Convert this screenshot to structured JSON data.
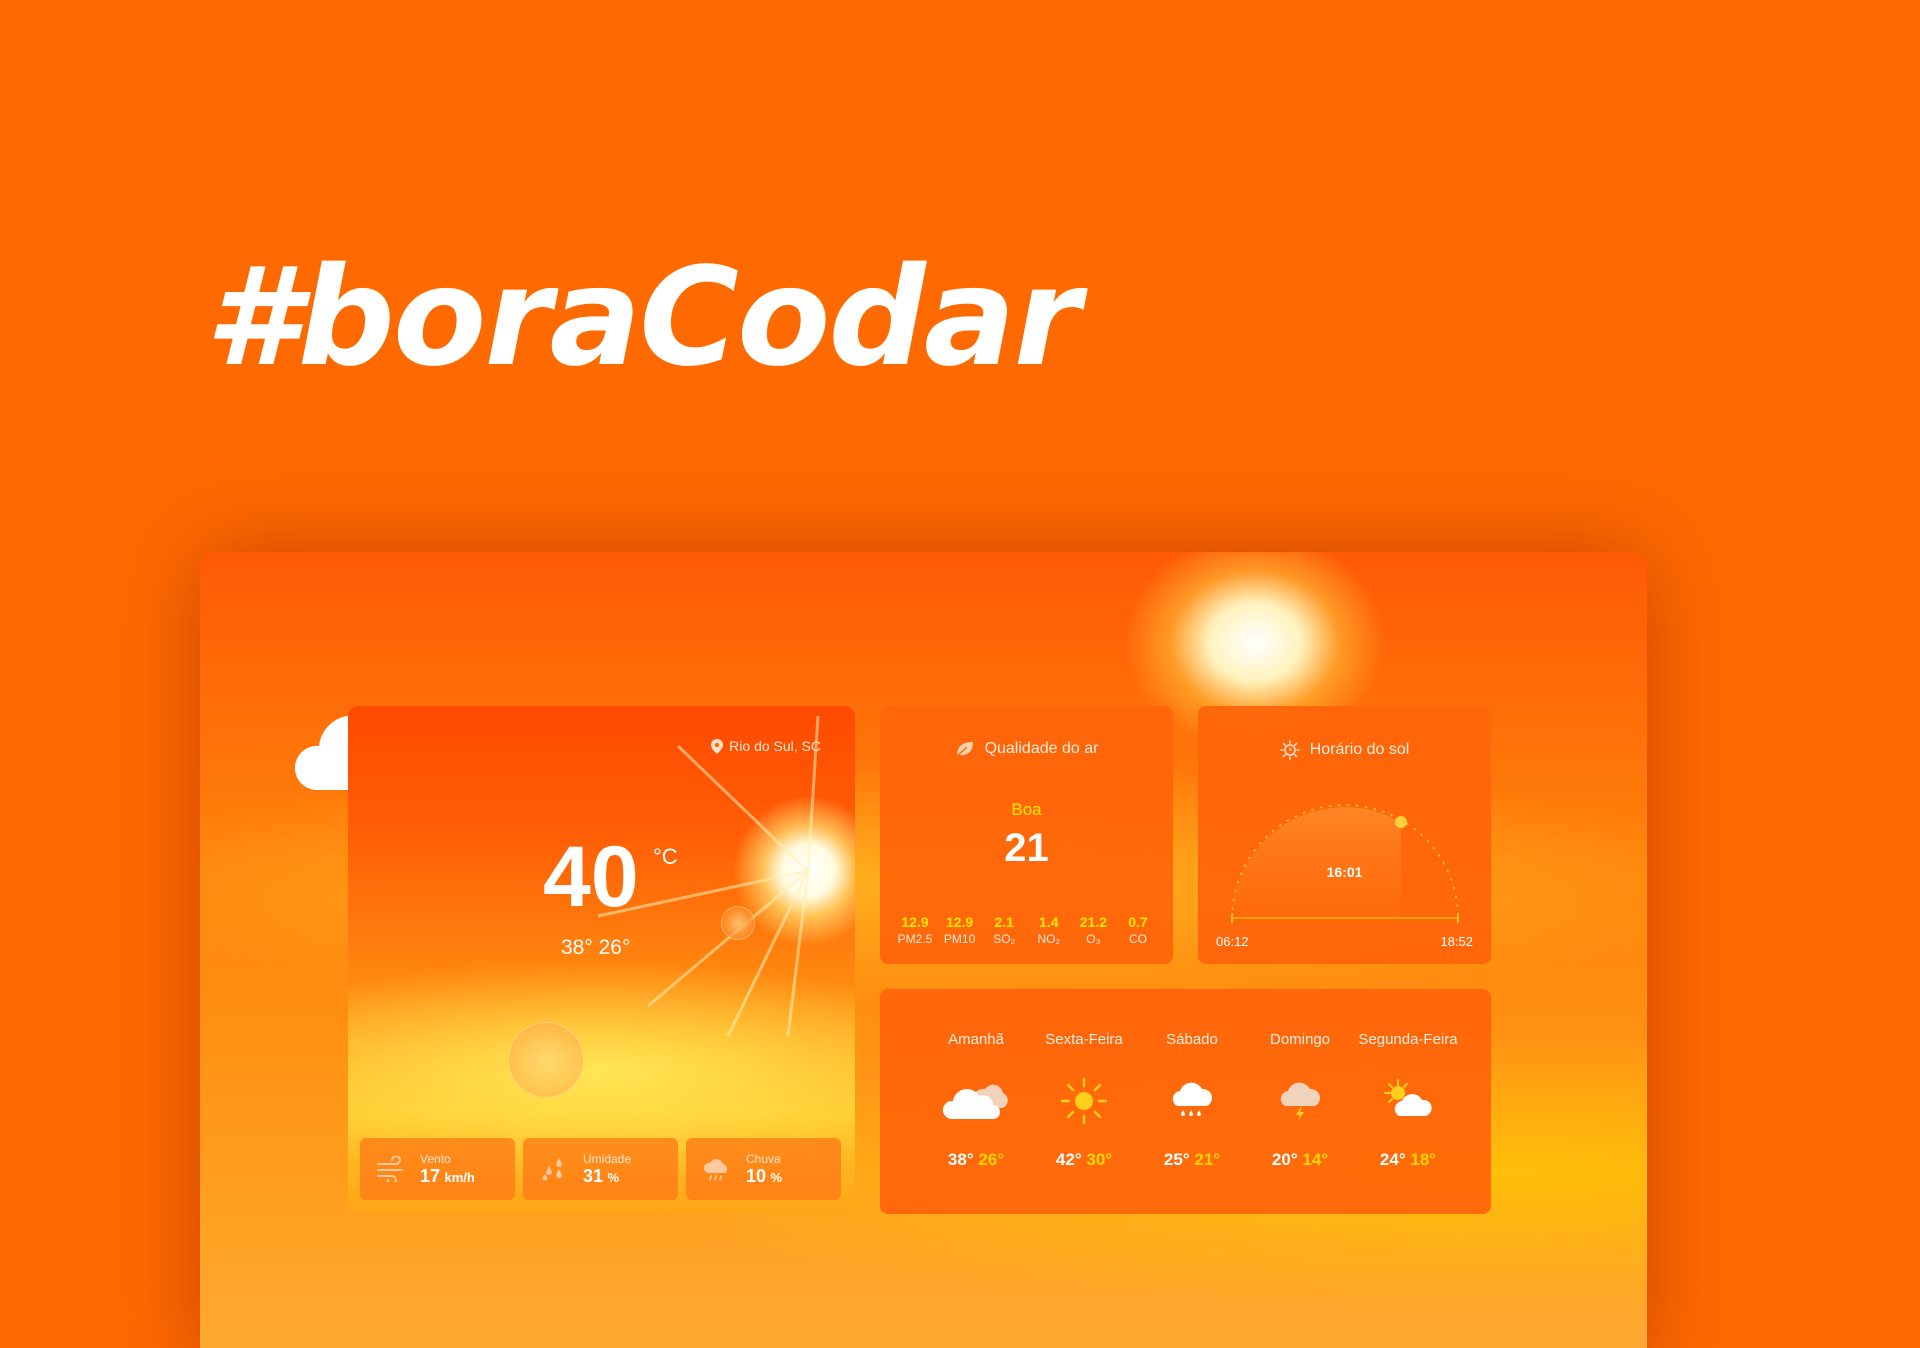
{
  "headline": "#boraCodar",
  "weather": {
    "location": "Rio do Sul, SC",
    "temperature": "40",
    "unit": "°C",
    "max": "38°",
    "min": "26°",
    "stats": [
      {
        "label": "Vento",
        "value": "17",
        "unit": "km/h",
        "icon": "wind-icon"
      },
      {
        "label": "Umidade",
        "value": "31",
        "unit": "%",
        "icon": "humidity-icon"
      },
      {
        "label": "Chuva",
        "value": "10",
        "unit": "%",
        "icon": "rain-cloud-icon"
      }
    ]
  },
  "air_quality": {
    "title": "Qualidade do ar",
    "status": "Boa",
    "index": "21",
    "pollutants": [
      {
        "value": "12.9",
        "label": "PM2.5"
      },
      {
        "value": "12.9",
        "label": "PM10"
      },
      {
        "value": "2.1",
        "label": "SO₂"
      },
      {
        "value": "1.4",
        "label": "NO₂"
      },
      {
        "value": "21.2",
        "label": "O₃"
      },
      {
        "value": "0.7",
        "label": "CO"
      }
    ]
  },
  "sun": {
    "title": "Horário do sol",
    "current_time": "16:01",
    "sunrise": "06:12",
    "sunset": "18:52"
  },
  "forecast": [
    {
      "day": "Amanhã",
      "max": "38°",
      "min": "26°",
      "icon": "cloudy-icon"
    },
    {
      "day": "Sexta-Feira",
      "max": "42°",
      "min": "30°",
      "icon": "sun-icon"
    },
    {
      "day": "Sábado",
      "max": "25°",
      "min": "21°",
      "icon": "rain-icon"
    },
    {
      "day": "Domingo",
      "max": "20°",
      "min": "14°",
      "icon": "storm-icon"
    },
    {
      "day": "Segunda-Feira",
      "max": "24°",
      "min": "18°",
      "icon": "partly-cloudy-icon"
    }
  ],
  "colors": {
    "background": "#ff6a00",
    "accent_yellow": "#ffe600"
  }
}
